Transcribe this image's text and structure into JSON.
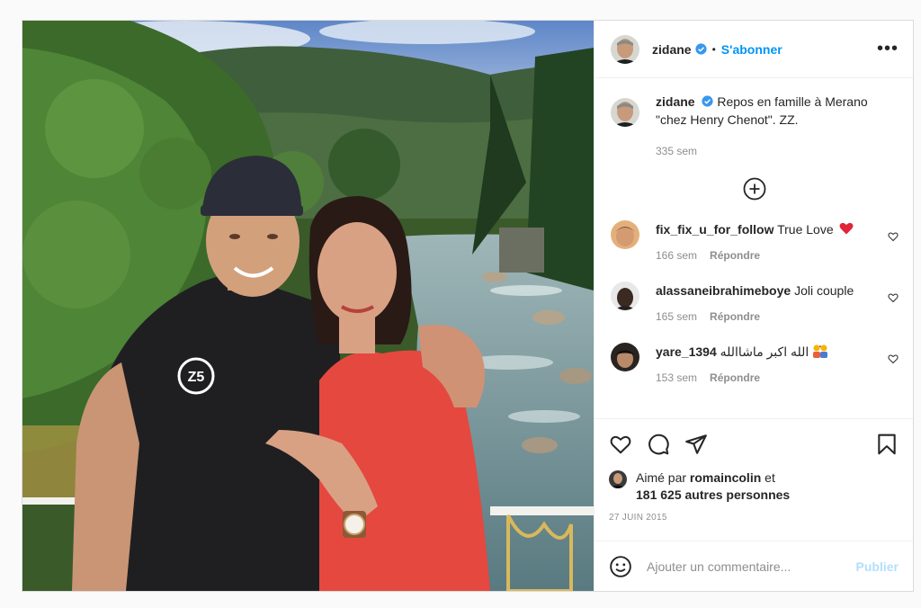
{
  "header": {
    "username": "zidane",
    "separator": "•",
    "follow_label": "S'abonner",
    "more_label": "•••"
  },
  "caption": {
    "username": "zidane",
    "text": "Repos en famille à Merano \"chez Henry Chenot\". ZZ.",
    "age": "335 sem"
  },
  "comments": [
    {
      "username": "fix_fix_u_for_follow",
      "text": "True Love",
      "emoji": "heart-emoji",
      "age": "166 sem",
      "reply_label": "Répondre"
    },
    {
      "username": "alassaneibrahimeboye",
      "text": "Joli couple",
      "age": "165 sem",
      "reply_label": "Répondre"
    },
    {
      "username": "yare_1394",
      "text": "الله اكبر ماشاالله",
      "emoji": "couple-emoji",
      "age": "153 sem",
      "reply_label": "Répondre"
    }
  ],
  "likes": {
    "prefix": "Aimé par",
    "user": "romaincolin",
    "joiner": "et",
    "others": "181 625 autres personnes"
  },
  "post_date": "27 JUIN 2015",
  "add_comment": {
    "placeholder": "Ajouter un commentaire...",
    "publish_label": "Publier"
  },
  "icons": {
    "verified": "verified-badge-icon",
    "more": "more-options-icon",
    "load_more": "plus-circle-icon",
    "like": "heart-icon",
    "comment": "comment-icon",
    "share": "paper-plane-icon",
    "save": "bookmark-icon",
    "emoji": "smiley-icon"
  },
  "colors": {
    "accent": "#0095f6",
    "publish_disabled": "#b2dffc",
    "heart_red": "#ed4956"
  }
}
